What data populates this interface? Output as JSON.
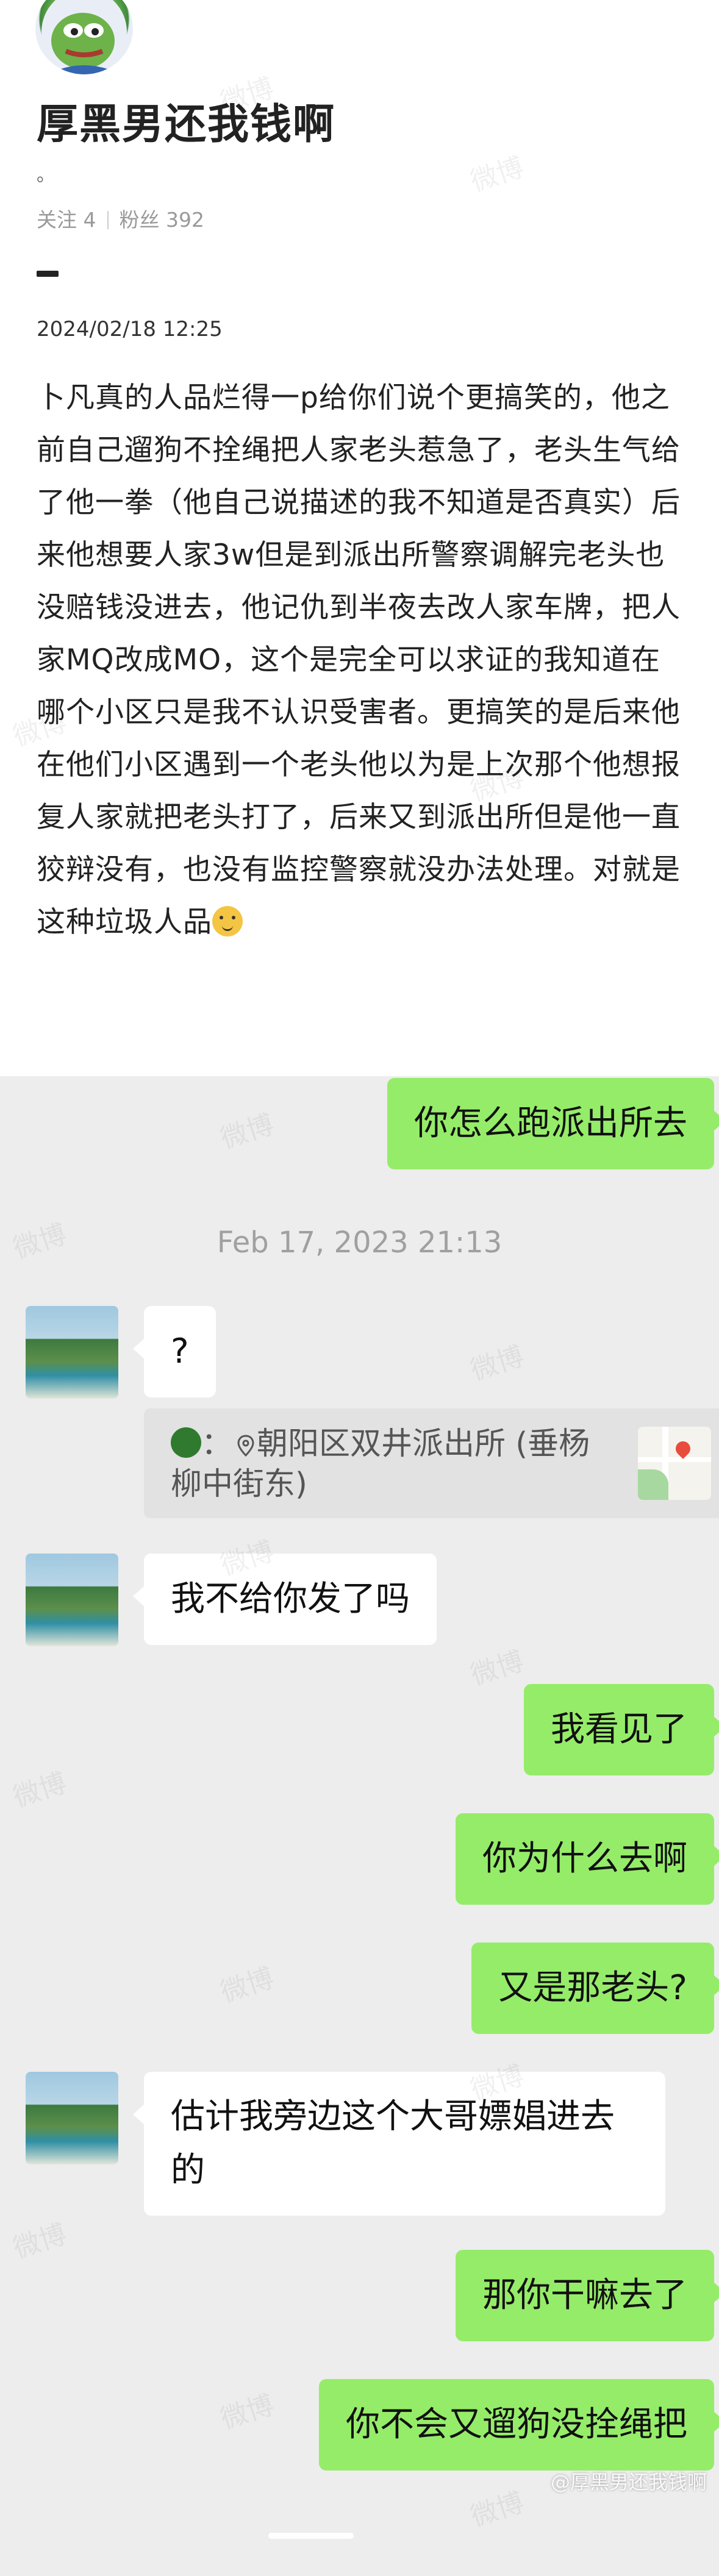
{
  "post": {
    "title": "厚黑男还我钱啊",
    "subtitle": "。",
    "following": "关注 4",
    "followers": "粉丝 392",
    "date": "2024/02/18 12:25",
    "body": "卜凡真的人品烂得一p给你们说个更搞笑的，他之前自己遛狗不拴绳把人家老头惹急了，老头生气给了他一拳（他自己说描述的我不知道是否真实）后来他想要人家3w但是到派出所警察调解完老头也没赔钱没进去，他记仇到半夜去改人家车牌，把人家MQ改成MO，这个是完全可以求证的我知道在哪个小区只是我不认识受害者。更搞笑的是后来他在他们小区遇到一个老头他以为是上次那个他想报复人家就把老头打了，后来又到派出所但是他一直狡辩没有，也没有监控警察就没办法处理。对就是这种垃圾人品"
  },
  "chat": {
    "messages": {
      "m1": "你怎么跑派出所去",
      "m2": "?",
      "m3": "我不给你发了吗",
      "m4": "我看见了",
      "m5": "你为什么去啊",
      "m6": "又是那老头?",
      "m7": "估计我旁边这个大哥嫖娼进去的",
      "m8": "那你干嘛去了",
      "m9": "你不会又遛狗没拴绳把"
    },
    "timestamp": "Feb 17, 2023 21:13",
    "quote": {
      "prefix": "：",
      "location": "朝阳区双井派出所 (垂杨柳中街东)"
    }
  },
  "watermarks": [
    "微博"
  ],
  "weibo_badge": "@厚黑男还我钱啊"
}
